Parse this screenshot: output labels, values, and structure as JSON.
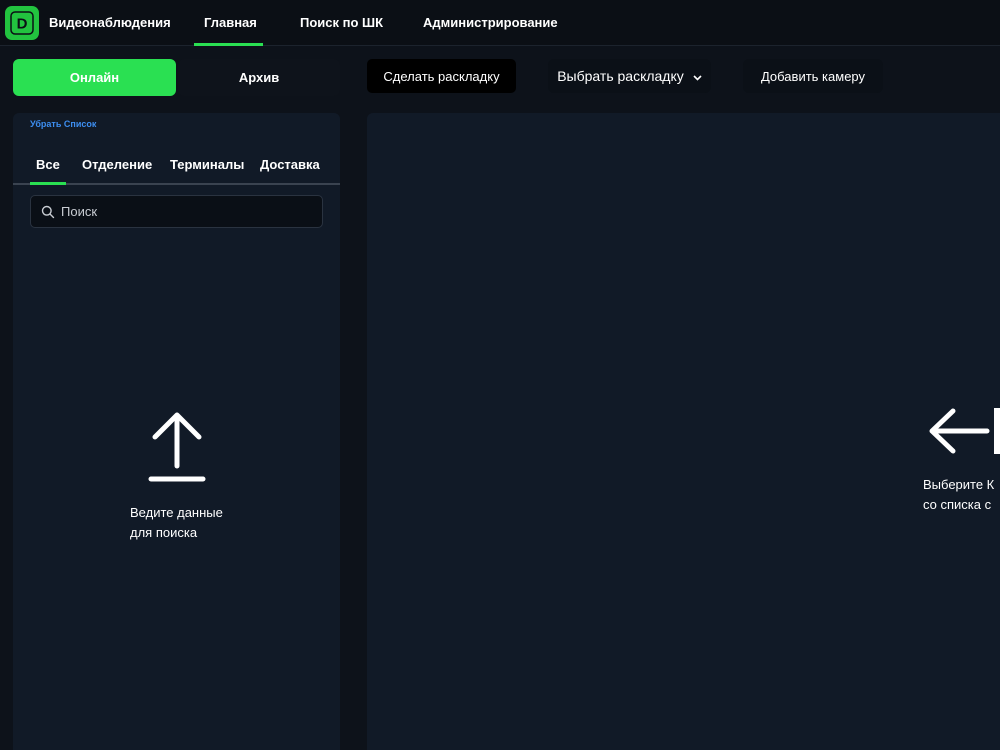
{
  "header": {
    "logo_letter": "D",
    "app_title": "Видеонаблюдения",
    "nav": [
      {
        "label": "Главная",
        "active": true
      },
      {
        "label": "Поиск по ШК"
      },
      {
        "label": "Администрирование"
      }
    ]
  },
  "toolbar": {
    "online_label": "Онлайн",
    "archive_label": "Архив",
    "make_layout_label": "Сделать раскладку",
    "select_layout_label": "Выбрать раскладку",
    "add_camera_label": "Добавить камеру"
  },
  "sidebar": {
    "hide_list_label": "Убрать Список",
    "tabs": [
      {
        "label": "Все",
        "active": true
      },
      {
        "label": "Отделение"
      },
      {
        "label": "Терминалы"
      },
      {
        "label": "Доставка"
      }
    ],
    "search": {
      "placeholder": "Поиск",
      "value": ""
    },
    "empty_hint": {
      "line1": "Ведите данные",
      "line2": "для поиска"
    }
  },
  "main": {
    "hint": {
      "line1": "Выберите К",
      "line2": "со списка с"
    }
  },
  "colors": {
    "accent": "#2ae052",
    "background": "#0d121a",
    "panel": "#111a27",
    "link": "#3d8ef0"
  }
}
